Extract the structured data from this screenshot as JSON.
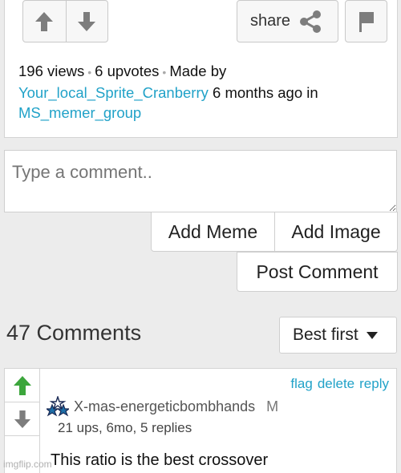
{
  "post": {
    "views": "196 views",
    "upvotes": "6 upvotes",
    "made_by": "Made by",
    "author": "Your_local_Sprite_Cranberry",
    "time_in": "6 months ago in",
    "stream": "MS_memer_group",
    "share_label": "share"
  },
  "compose": {
    "placeholder": "Type a comment..",
    "add_meme": "Add Meme",
    "add_image": "Add Image",
    "post_comment": "Post Comment"
  },
  "comments_header": {
    "count_label": "47 Comments",
    "sort_value": "Best first"
  },
  "comment": {
    "actions": [
      "flag",
      "delete",
      "reply"
    ],
    "username": "X-mas-energeticbombhands",
    "badge": "M",
    "stats": "21 ups, 6mo, 5 replies",
    "text": "This ratio is the best crossover"
  },
  "watermark": "imgflip.com",
  "colors": {
    "link": "#21a2c8",
    "upvote_active": "#3ca63c",
    "icon_gray": "#7d7d7d"
  }
}
